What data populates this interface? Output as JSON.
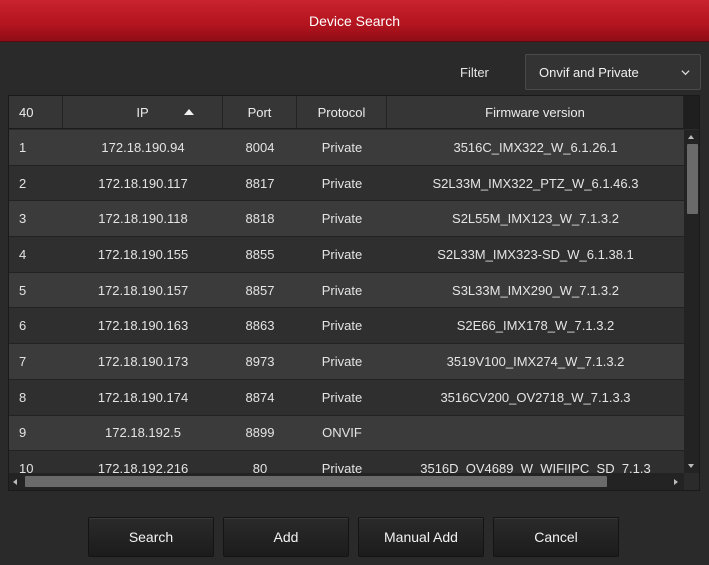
{
  "window": {
    "title": "Device Search"
  },
  "filter": {
    "label": "Filter",
    "selected": "Onvif and Private"
  },
  "table": {
    "headers": {
      "index": "40",
      "ip": "IP",
      "port": "Port",
      "protocol": "Protocol",
      "firmware": "Firmware version"
    },
    "rows": [
      {
        "index": "1",
        "ip": "172.18.190.94",
        "port": "8004",
        "protocol": "Private",
        "firmware": "3516C_IMX322_W_6.1.26.1"
      },
      {
        "index": "2",
        "ip": "172.18.190.117",
        "port": "8817",
        "protocol": "Private",
        "firmware": "S2L33M_IMX322_PTZ_W_6.1.46.3"
      },
      {
        "index": "3",
        "ip": "172.18.190.118",
        "port": "8818",
        "protocol": "Private",
        "firmware": "S2L55M_IMX123_W_7.1.3.2"
      },
      {
        "index": "4",
        "ip": "172.18.190.155",
        "port": "8855",
        "protocol": "Private",
        "firmware": "S2L33M_IMX323-SD_W_6.1.38.1"
      },
      {
        "index": "5",
        "ip": "172.18.190.157",
        "port": "8857",
        "protocol": "Private",
        "firmware": "S3L33M_IMX290_W_7.1.3.2"
      },
      {
        "index": "6",
        "ip": "172.18.190.163",
        "port": "8863",
        "protocol": "Private",
        "firmware": "S2E66_IMX178_W_7.1.3.2"
      },
      {
        "index": "7",
        "ip": "172.18.190.173",
        "port": "8973",
        "protocol": "Private",
        "firmware": "3519V100_IMX274_W_7.1.3.2"
      },
      {
        "index": "8",
        "ip": "172.18.190.174",
        "port": "8874",
        "protocol": "Private",
        "firmware": "3516CV200_OV2718_W_7.1.3.3"
      },
      {
        "index": "9",
        "ip": "172.18.192.5",
        "port": "8899",
        "protocol": "ONVIF",
        "firmware": ""
      },
      {
        "index": "10",
        "ip": "172.18.192.216",
        "port": "80",
        "protocol": "Private",
        "firmware": "3516D_OV4689_W_WIFIIPC_SD_7.1.3"
      }
    ]
  },
  "buttons": {
    "search": "Search",
    "add": "Add",
    "manual_add": "Manual Add",
    "cancel": "Cancel"
  },
  "icons": {
    "sort": "sort-ascending-icon",
    "dropdown": "chevron-down-icon"
  },
  "colors": {
    "titlebar": "#b3141e",
    "background": "#2a2a2a"
  }
}
